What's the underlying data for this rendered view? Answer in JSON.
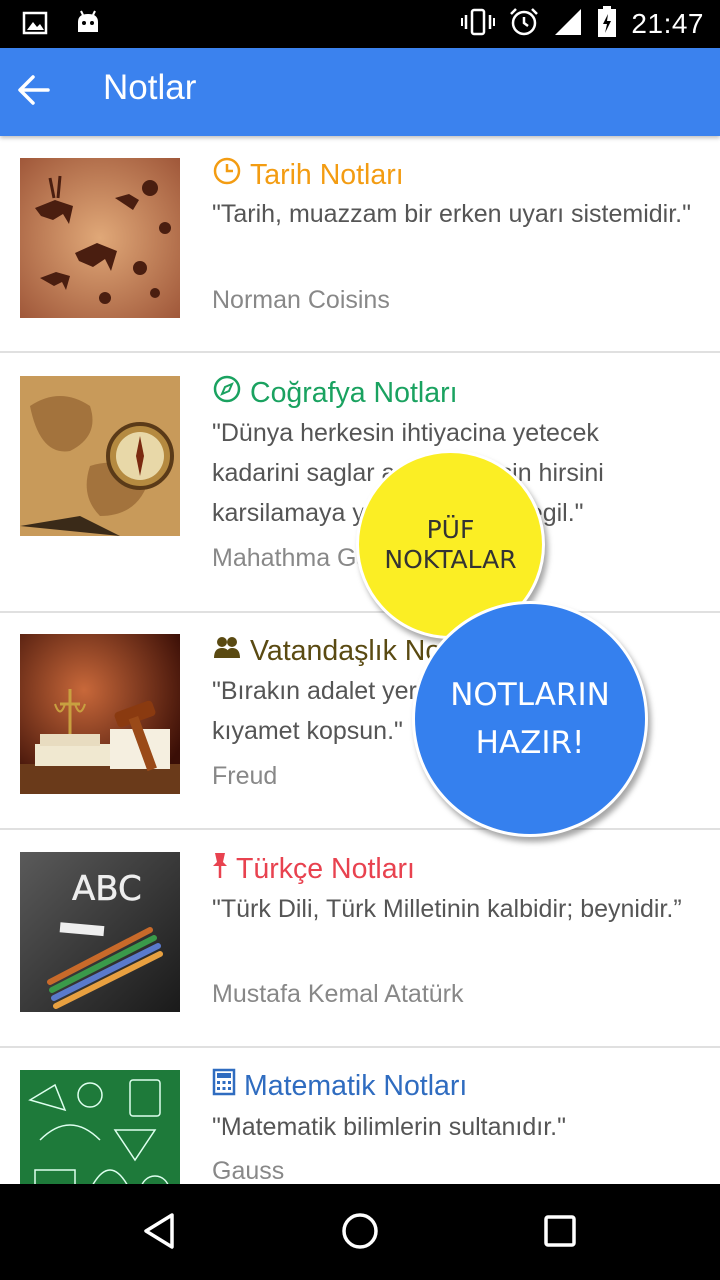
{
  "status_bar": {
    "time": "21:47",
    "icons": [
      "image-icon",
      "android-icon",
      "vibrate-icon",
      "alarm-icon",
      "signal-icon",
      "battery-icon"
    ]
  },
  "app_bar": {
    "title": "Notlar",
    "color": "#3b82ee"
  },
  "items": [
    {
      "title": "Tarih Notları",
      "icon": "clock-icon",
      "color": "#f39c12",
      "quote": "\"Tarih, muazzam bir erken uyarı sistemidir.\"",
      "author": "Norman Coisins"
    },
    {
      "title": "Coğrafya Notları",
      "icon": "compass-icon",
      "color": "#1aa260",
      "quote": "\"Dünya herkesin ihtiyacina yetecek kadarini saglar ama herkesin hirsini karsilamaya yetecek kadar degil.\"",
      "author": "Mahathma Gandhi"
    },
    {
      "title": "Vatandaşlık Notları",
      "icon": "users-icon",
      "color": "#5a4a12",
      "quote": "\"Bırakın adalet yerini bulsun, isterse kıyamet kopsun.\"",
      "author": "Freud"
    },
    {
      "title": "Türkçe Notları",
      "icon": "pin-icon",
      "color": "#e8424f",
      "quote": "\"Türk Dili, Türk Milletinin kalbidir; beynidir.”",
      "author": "Mustafa Kemal Atatürk"
    },
    {
      "title": "Matematik Notları",
      "icon": "calculator-icon",
      "color": "#2f6cc0",
      "quote": "\"Matematik bilimlerin sultanıdır.\"",
      "author": "Gauss"
    }
  ],
  "bubbles": {
    "tips": "PÜF NOKTALAR",
    "ready": "NOTLARIN HAZIR!"
  },
  "nav": [
    "back-icon",
    "home-icon",
    "recents-icon"
  ]
}
